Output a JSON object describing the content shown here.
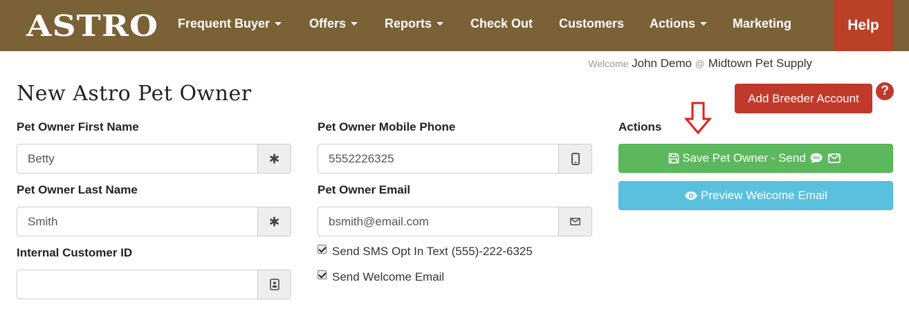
{
  "navbar": {
    "logo": "ASTRO",
    "items": [
      {
        "label": "Frequent Buyer",
        "dropdown": true
      },
      {
        "label": "Offers",
        "dropdown": true
      },
      {
        "label": "Reports",
        "dropdown": true
      },
      {
        "label": "Check Out",
        "dropdown": false
      },
      {
        "label": "Customers",
        "dropdown": false
      },
      {
        "label": "Actions",
        "dropdown": true
      },
      {
        "label": "Marketing",
        "dropdown": false
      }
    ],
    "help_label": "Help",
    "background_color": "#7a6136",
    "help_color": "#b94127"
  },
  "welcome": {
    "prefix": "Welcome",
    "user": "John Demo",
    "at": "@",
    "store": "Midtown Pet Supply"
  },
  "page": {
    "title": "New Astro Pet Owner",
    "add_breeder_label": "Add Breeder Account",
    "help_icon_glyph": "?"
  },
  "form": {
    "first_name": {
      "label": "Pet Owner First Name",
      "value": "Betty",
      "icon": "asterisk-icon"
    },
    "last_name": {
      "label": "Pet Owner Last Name",
      "value": "Smith",
      "icon": "asterisk-icon"
    },
    "customer_id": {
      "label": "Internal Customer ID",
      "value": "",
      "icon": "id-card-icon"
    },
    "mobile_phone": {
      "label": "Pet Owner Mobile Phone",
      "value": "5552226325",
      "icon": "mobile-phone-icon"
    },
    "email": {
      "label": "Pet Owner Email",
      "value": "bsmith@email.com",
      "icon": "envelope-icon"
    },
    "sms_opt_in": {
      "label": "Send SMS Opt In Text (555)-222-6325",
      "checked": true
    },
    "welcome_email": {
      "label": "Send Welcome Email",
      "checked": true
    }
  },
  "actions": {
    "heading": "Actions",
    "save_label": "Save Pet Owner - Send",
    "preview_label": "Preview Welcome Email",
    "save_color": "#5cb85c",
    "preview_color": "#5bc0de",
    "annotation_arrow_color": "#e02020"
  }
}
